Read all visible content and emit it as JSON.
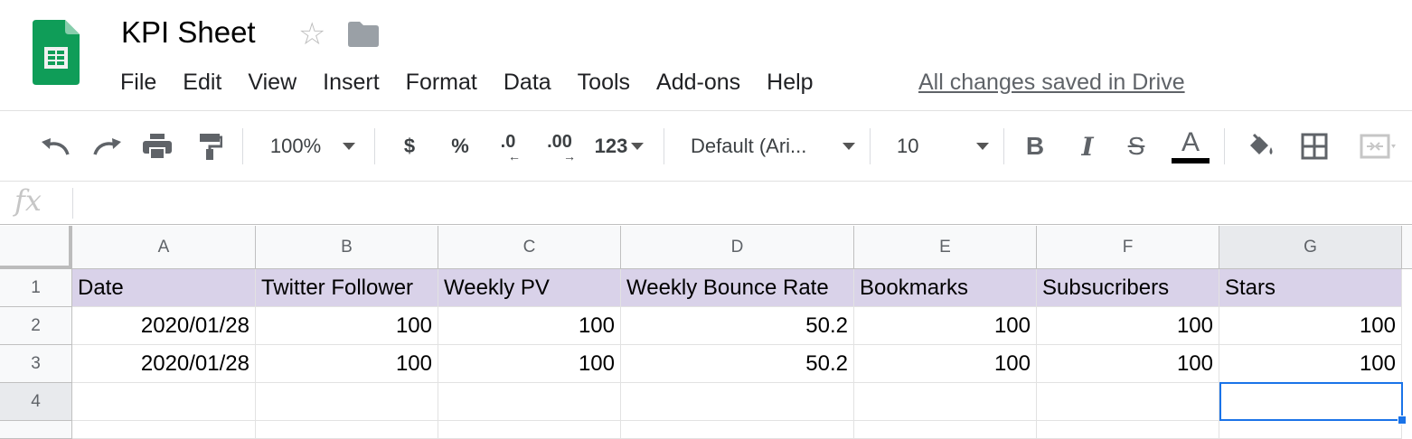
{
  "app": {
    "title": "KPI Sheet",
    "save_status": "All changes saved in Drive",
    "brand_color": "#0f9d58"
  },
  "menu": [
    "File",
    "Edit",
    "View",
    "Insert",
    "Format",
    "Data",
    "Tools",
    "Add-ons",
    "Help"
  ],
  "toolbar": {
    "zoom": "100%",
    "currency": "$",
    "percent": "%",
    "decrease_decimal": ".0",
    "increase_decimal": ".00",
    "more_formats": "123",
    "font": "Default (Ari...",
    "font_size": "10",
    "bold": "B",
    "italic": "I",
    "strikethrough": "S",
    "text_color": "A",
    "icons": [
      "undo-icon",
      "redo-icon",
      "print-icon",
      "paint-format-icon",
      "fill-color-icon",
      "borders-icon",
      "merge-cells-icon"
    ]
  },
  "formula_bar": {
    "label": "fx",
    "value": ""
  },
  "sheet": {
    "columns": [
      "A",
      "B",
      "C",
      "D",
      "E",
      "F",
      "G"
    ],
    "row_numbers": [
      "1",
      "2",
      "3",
      "4"
    ],
    "rows": [
      [
        "Date",
        "Twitter Follower",
        "Weekly PV",
        "Weekly Bounce Rate",
        "Bookmarks",
        "Subsucribers",
        "Stars"
      ],
      [
        "2020/01/28",
        "100",
        "100",
        "50.2",
        "100",
        "100",
        "100"
      ],
      [
        "2020/01/28",
        "100",
        "100",
        "50.2",
        "100",
        "100",
        "100"
      ],
      [
        "",
        "",
        "",
        "",
        "",
        "",
        ""
      ]
    ],
    "header_row_color": "#d9d2e9",
    "selected_cell": "G4",
    "selection_color": "#1a73e8"
  }
}
